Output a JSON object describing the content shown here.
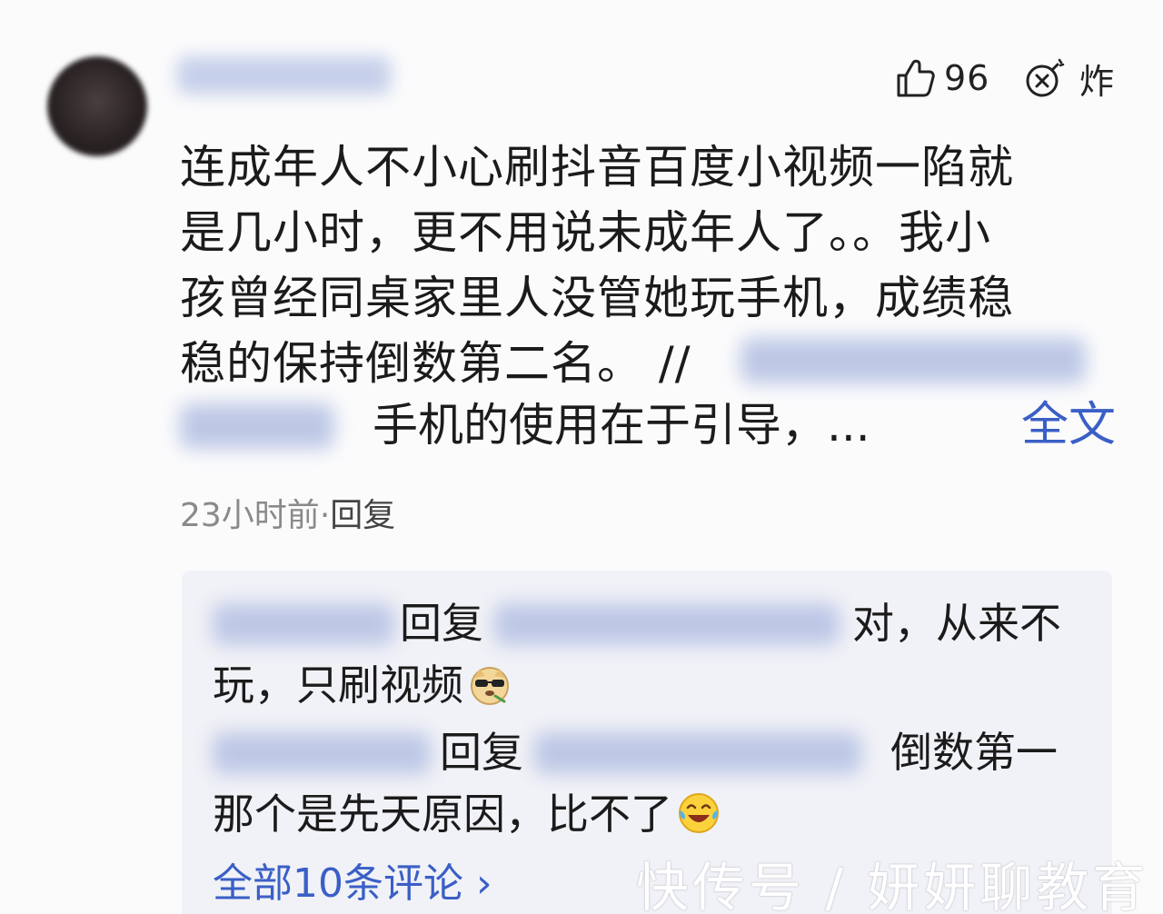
{
  "comment": {
    "likes": "96",
    "bomb_label": "炸",
    "lines": [
      "连成年人不小心刷抖音百度小视频一陷就",
      "是几小时，更不用说未成年人了。。我小",
      "孩曾经同桌家里人没管她玩手机，成绩稳",
      "稳的保持倒数第二名。 //"
    ],
    "line5_tail": "手机的使用在于引导，...",
    "fulltext_label": "全文",
    "time": "23小时前",
    "dot": "·",
    "reply_label": "回复"
  },
  "replies": [
    {
      "reply_word": "回复",
      "line1_tail": "对，从来不",
      "line2": "玩，只刷视频",
      "emoji": "cool-dog-emoji"
    },
    {
      "reply_word": "回复",
      "line1_tail": "倒数第一",
      "line2": "那个是先天原因，比不了",
      "emoji": "laugh-cry-emoji"
    }
  ],
  "all_comments_label": "全部10条评论 ›",
  "watermark": "快传号 / 妍妍聊教育",
  "colors": {
    "link": "#3a5fc6",
    "meta": "#8a8a8a",
    "reply_bg": "#f1f2f7"
  }
}
